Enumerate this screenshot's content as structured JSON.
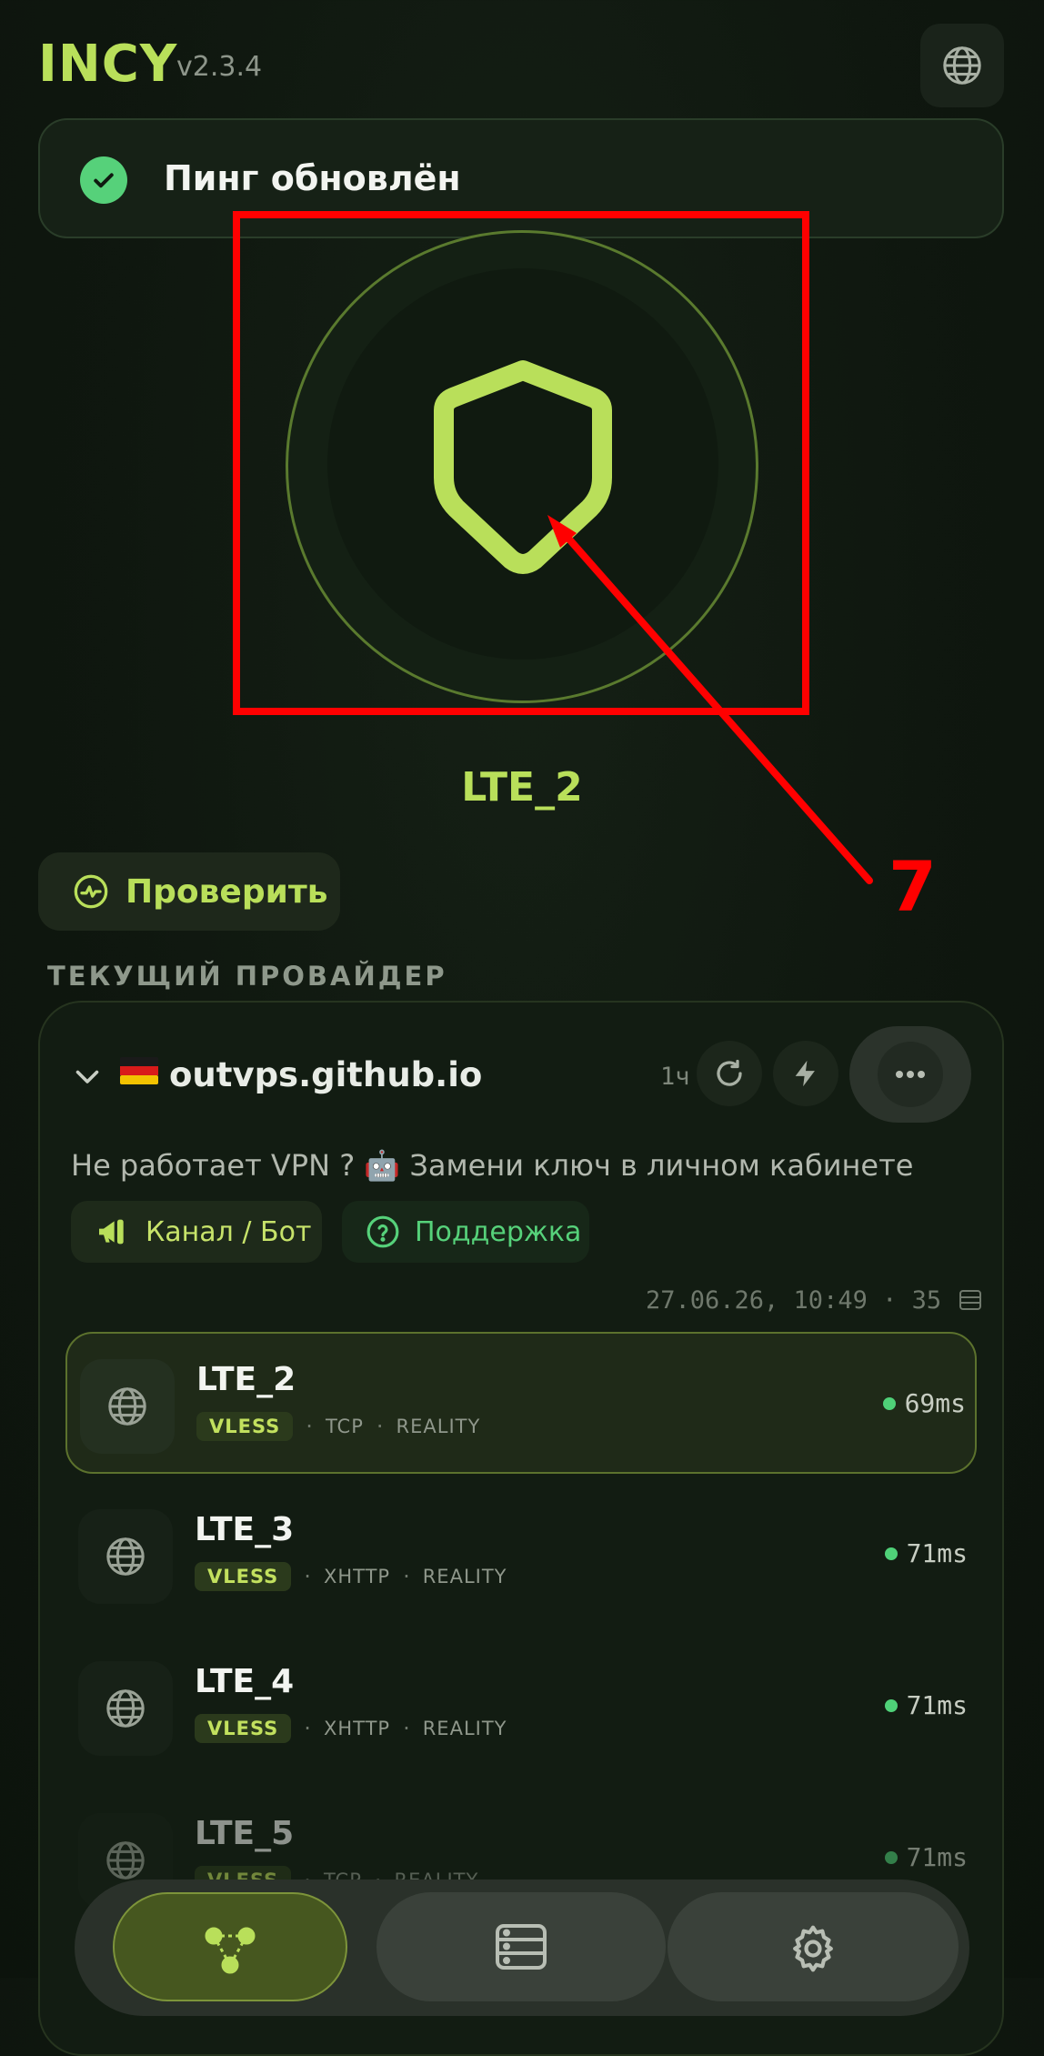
{
  "header": {
    "brand": "INCY",
    "version": "v2.3.4"
  },
  "toast": {
    "text": "Пинг обновлён"
  },
  "connection": {
    "server_name": "LTE_2"
  },
  "annotation": {
    "label": "7"
  },
  "check_button": {
    "label": "Проверить"
  },
  "section": {
    "label": "ТЕКУЩИЙ ПРОВАЙДЕР"
  },
  "provider": {
    "flag": "🇩🇪",
    "name": "outvps.github.io",
    "update_interval": "1ч",
    "notice": "Не работает VPN ? 🤖 Замени ключ в личном кабинете",
    "channel_label": "Канал / Бот",
    "support_label": "Поддержка",
    "meta": "27.06.26, 10:49 · 35"
  },
  "servers": [
    {
      "name": "LTE_2",
      "protocol": "VLESS",
      "transport": "TCP",
      "security": "REALITY",
      "ping": "69ms",
      "active": true
    },
    {
      "name": "LTE_3",
      "protocol": "VLESS",
      "transport": "XHTTP",
      "security": "REALITY",
      "ping": "71ms",
      "active": false
    },
    {
      "name": "LTE_4",
      "protocol": "VLESS",
      "transport": "XHTTP",
      "security": "REALITY",
      "ping": "71ms",
      "active": false
    },
    {
      "name": "LTE_5",
      "protocol": "VLESS",
      "transport": "TCP",
      "security": "REALITY",
      "ping": "71ms",
      "active": false
    }
  ],
  "colors": {
    "accent": "#b9df5a",
    "success": "#56d17a",
    "annotation": "#ff0000"
  }
}
